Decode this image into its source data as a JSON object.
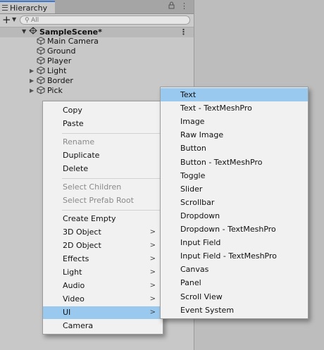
{
  "window": {
    "tab_title": "Hierarchy",
    "tab_icons": [
      "lock-icon",
      "kebab-menu-icon"
    ]
  },
  "toolbar": {
    "add_label": "+",
    "search_placeholder": "All"
  },
  "scene": {
    "name": "SampleScene*",
    "kebab": "⋮"
  },
  "tree": [
    {
      "label": "Main Camera",
      "expandable": false
    },
    {
      "label": "Ground",
      "expandable": false
    },
    {
      "label": "Player",
      "expandable": false
    },
    {
      "label": "Light",
      "expandable": true
    },
    {
      "label": "Border",
      "expandable": true
    },
    {
      "label": "Pick",
      "expandable": true
    }
  ],
  "context_menu": {
    "items": [
      {
        "label": "Copy",
        "enabled": true
      },
      {
        "label": "Paste",
        "enabled": true
      },
      {
        "label": "Rename",
        "enabled": false
      },
      {
        "label": "Duplicate",
        "enabled": true
      },
      {
        "label": "Delete",
        "enabled": true
      },
      {
        "label": "Select Children",
        "enabled": false
      },
      {
        "label": "Select Prefab Root",
        "enabled": false
      },
      {
        "label": "Create Empty",
        "enabled": true
      },
      {
        "label": "3D Object",
        "enabled": true,
        "submenu": true
      },
      {
        "label": "2D Object",
        "enabled": true,
        "submenu": true
      },
      {
        "label": "Effects",
        "enabled": true,
        "submenu": true
      },
      {
        "label": "Light",
        "enabled": true,
        "submenu": true
      },
      {
        "label": "Audio",
        "enabled": true,
        "submenu": true
      },
      {
        "label": "Video",
        "enabled": true,
        "submenu": true
      },
      {
        "label": "UI",
        "enabled": true,
        "submenu": true,
        "highlighted": true
      },
      {
        "label": "Camera",
        "enabled": true
      }
    ],
    "chevron": ">"
  },
  "ui_submenu": {
    "items": [
      {
        "label": "Text",
        "highlighted": true
      },
      {
        "label": "Text - TextMeshPro"
      },
      {
        "label": "Image"
      },
      {
        "label": "Raw Image"
      },
      {
        "label": "Button"
      },
      {
        "label": "Button - TextMeshPro"
      },
      {
        "label": "Toggle"
      },
      {
        "label": "Slider"
      },
      {
        "label": "Scrollbar"
      },
      {
        "label": "Dropdown"
      },
      {
        "label": "Dropdown - TextMeshPro"
      },
      {
        "label": "Input Field"
      },
      {
        "label": "Input Field - TextMeshPro"
      },
      {
        "label": "Canvas"
      },
      {
        "label": "Panel"
      },
      {
        "label": "Scroll View"
      },
      {
        "label": "Event System"
      }
    ]
  },
  "colors": {
    "highlight": "#99c9ef",
    "tab_accent": "#3a79d8",
    "menu_bg": "#f1f1f1"
  }
}
